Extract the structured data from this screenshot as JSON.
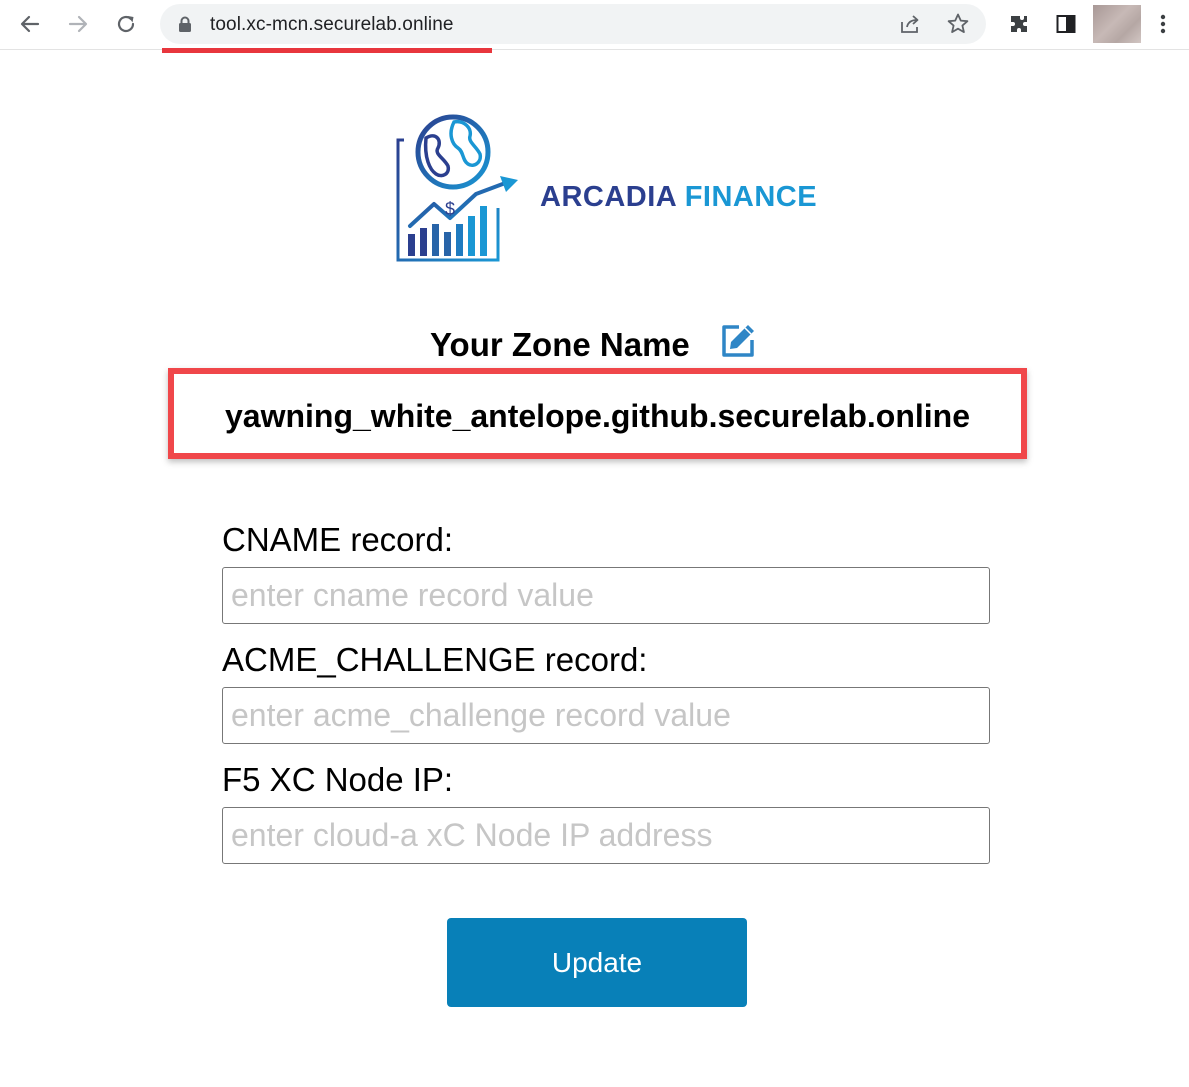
{
  "browser": {
    "url": "tool.xc-mcn.securelab.online",
    "icons": [
      "back-arrow-icon",
      "forward-arrow-icon",
      "reload-icon",
      "lock-icon",
      "share-icon",
      "star-icon",
      "extensions-icon",
      "side-panel-icon",
      "profile-avatar",
      "kebab-menu-icon"
    ]
  },
  "brand": {
    "word1": "ARCADIA",
    "word2": "FINANCE",
    "colors": {
      "dark": "#2b3f8f",
      "light": "#1a97d4"
    }
  },
  "zone": {
    "title": "Your Zone Name",
    "value": "yawning_white_antelope.github.securelab.online",
    "highlight_color": "#f0474a"
  },
  "form": {
    "cname_label": "CNAME record:",
    "cname_placeholder": "enter cname record value",
    "acme_label": "ACME_CHALLENGE record:",
    "acme_placeholder": "enter acme_challenge record value",
    "nodeip_label": "F5 XC Node IP:",
    "nodeip_placeholder": "enter cloud-a xC Node IP address",
    "submit_label": "Update",
    "submit_color": "#0880b8"
  }
}
